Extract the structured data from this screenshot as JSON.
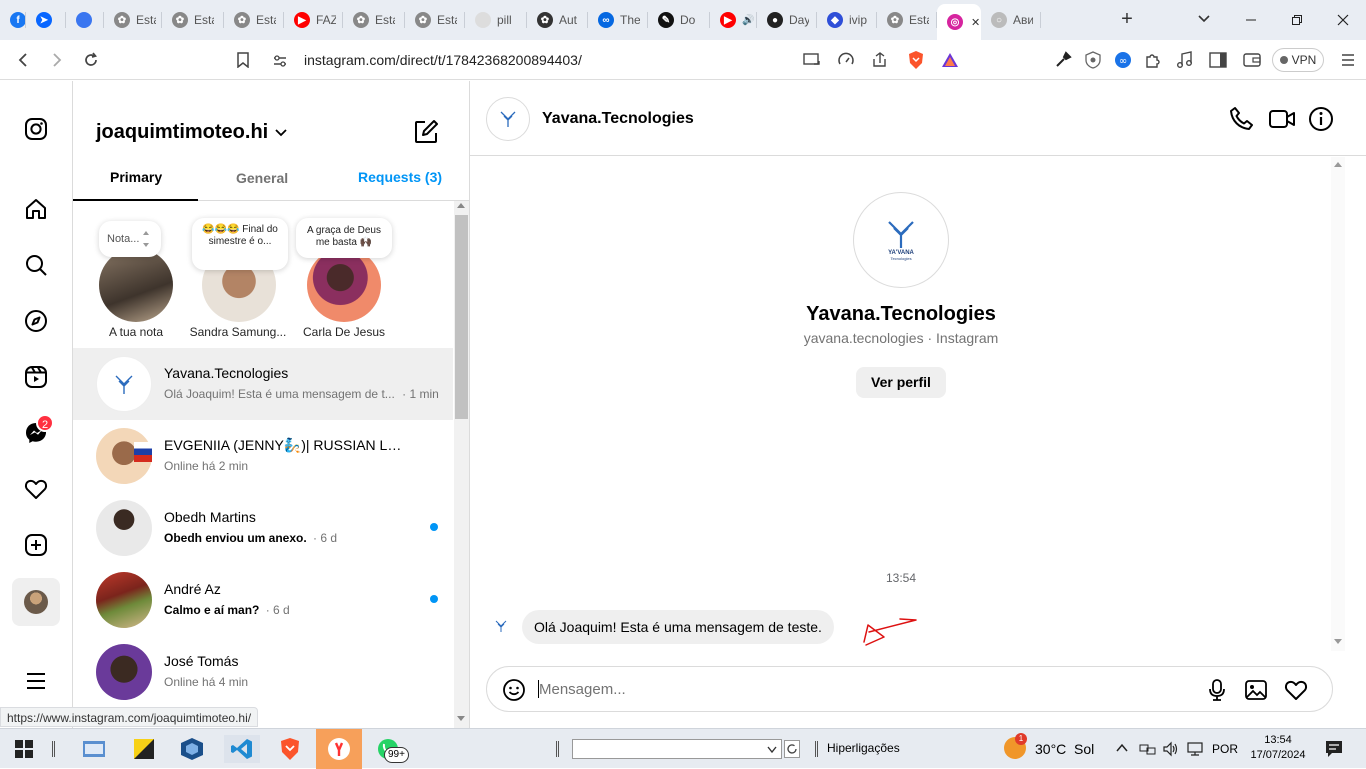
{
  "browser": {
    "tabs": [
      {
        "title": "",
        "icon": "facebook-icon",
        "color": "#1877f2"
      },
      {
        "title": "",
        "icon": "messenger-icon",
        "color": "#0866ff"
      },
      {
        "title": "",
        "icon": "signal-icon",
        "color": "#3a76f0"
      },
      {
        "title": "Esta",
        "icon": "openai-icon",
        "color": "#888"
      },
      {
        "title": "Esta",
        "icon": "openai-icon",
        "color": "#888"
      },
      {
        "title": "Esta",
        "icon": "openai-icon",
        "color": "#888"
      },
      {
        "title": "FAZ",
        "icon": "youtube-icon",
        "color": "#ff0000"
      },
      {
        "title": "Esta",
        "icon": "openai-icon",
        "color": "#888"
      },
      {
        "title": "Esta",
        "icon": "openai-icon",
        "color": "#888"
      },
      {
        "title": "pill",
        "icon": "doc-icon",
        "color": "#ddd"
      },
      {
        "title": "Aut",
        "icon": "openai-icon",
        "color": "#333"
      },
      {
        "title": "The",
        "icon": "meta-icon",
        "color": "#0668e1"
      },
      {
        "title": "Do",
        "icon": "pencil-icon",
        "color": "#111"
      },
      {
        "title": "",
        "icon": "youtube-icon",
        "color": "#ff0000"
      },
      {
        "title": "Day",
        "icon": "github-icon",
        "color": "#222"
      },
      {
        "title": "ivip",
        "icon": "app-icon",
        "color": "#2f4fd8"
      },
      {
        "title": "Esta",
        "icon": "openai-icon",
        "color": "#888"
      },
      {
        "title": "",
        "icon": "instagram-icon",
        "color": "#d6249f"
      },
      {
        "title": "Ави",
        "icon": "loading-icon",
        "color": "#bbb"
      }
    ],
    "url": "instagram.com/direct/t/17842368200894403/",
    "vpn_label": "VPN",
    "status_url": "https://www.instagram.com/joaquimtimoteo.hi/"
  },
  "sidebar": {
    "username": "joaquimtimoteo.hi",
    "tabs": {
      "primary": "Primary",
      "general": "General",
      "requests": "Requests (3)"
    },
    "notification_count": "2"
  },
  "notes": [
    {
      "bubble": "Nota...",
      "name": "A tua nota"
    },
    {
      "bubble": "😂😂😂 Final do simestre é o...",
      "name": "Sandra Samung..."
    },
    {
      "bubble": "A graça de Deus me basta 🙌🏿",
      "name": "Carla De Jesus"
    }
  ],
  "conversations": [
    {
      "name": "Yavana.Tecnologies",
      "preview": "Olá Joaquim! Esta é uma mensagem de t...",
      "time": "· 1 min",
      "bold": false,
      "unread": false
    },
    {
      "name": "EVGENIIA (JENNY🧞)| RUSSIAN LAN...",
      "preview": "Online há 2 min",
      "time": "",
      "bold": false,
      "unread": false
    },
    {
      "name": "Obedh Martins",
      "preview": "Obedh enviou um anexo.",
      "time": "· 6 d",
      "bold": true,
      "unread": true
    },
    {
      "name": "André Az",
      "preview": "Calmo e aí man?",
      "time": "· 6 d",
      "bold": true,
      "unread": true
    },
    {
      "name": "José Tomás",
      "preview": "Online há 4 min",
      "time": "",
      "bold": false,
      "unread": false
    }
  ],
  "chat": {
    "header_name": "Yavana.Tecnologies",
    "profile_name": "Yavana.Tecnologies",
    "profile_sub": "yavana.tecnologies · Instagram",
    "view_profile": "Ver perfil",
    "logo_text": "YA'VANA",
    "logo_sub": "Tecnologies",
    "timestamp": "13:54",
    "message": "Olá Joaquim! Esta é uma mensagem de teste.",
    "input_placeholder": "Mensagem..."
  },
  "taskbar": {
    "links_label": "Hiperligações",
    "weather": "30°C  Sol",
    "lang": "POR",
    "time": "13:54",
    "date": "17/07/2024",
    "whatsapp_badge": "99+",
    "weather_badge": "1"
  },
  "colors": {
    "accent": "#0095f6",
    "notif": "#ff3040"
  }
}
